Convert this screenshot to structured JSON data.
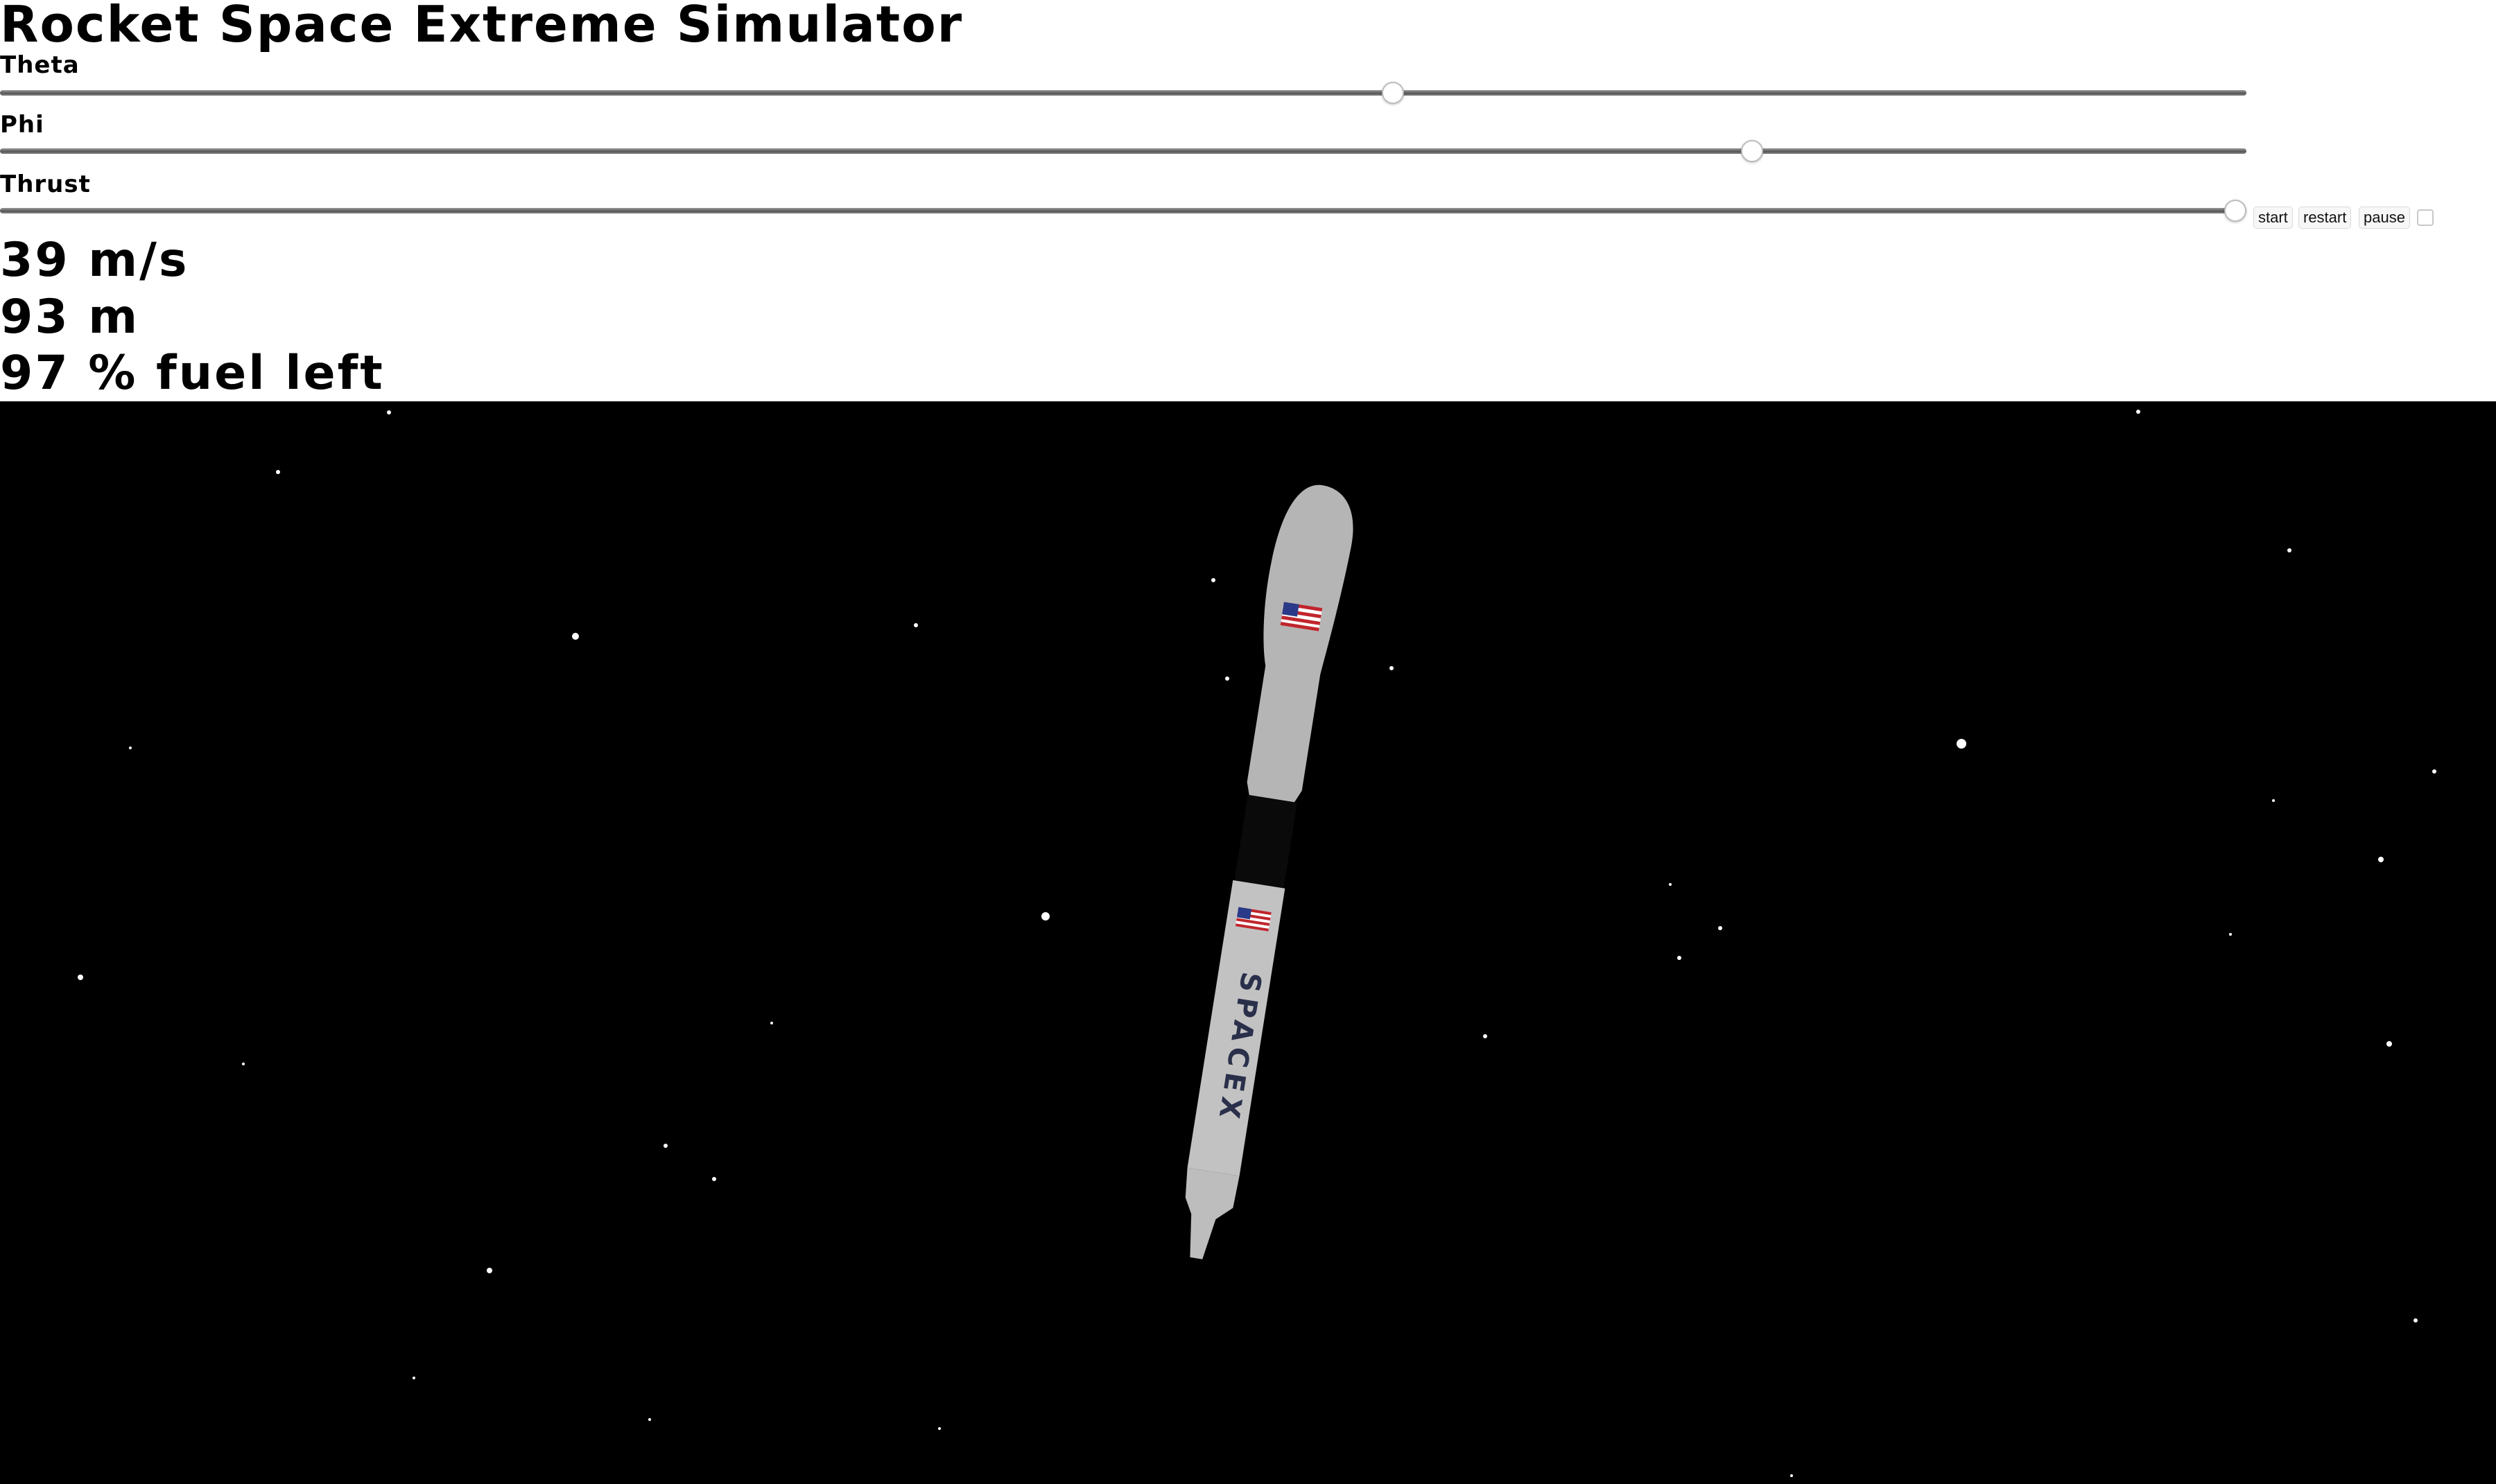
{
  "title": "Rocket Space Extreme Simulator",
  "controls": {
    "theta": {
      "label": "Theta",
      "value": 0.62
    },
    "phi": {
      "label": "Phi",
      "value": 0.78
    },
    "thrust": {
      "label": "Thrust",
      "value": 0.995
    }
  },
  "buttons": {
    "start": "start",
    "restart": "restart",
    "pause": "pause"
  },
  "pause_checkbox_checked": false,
  "readouts": {
    "velocity": "39 m/s",
    "altitude": "93 m",
    "fuel": "97 % fuel left"
  },
  "scene": {
    "background": "#000000",
    "rocket_color": "#b5b5b5",
    "rocket_brand": "SPACEX"
  }
}
